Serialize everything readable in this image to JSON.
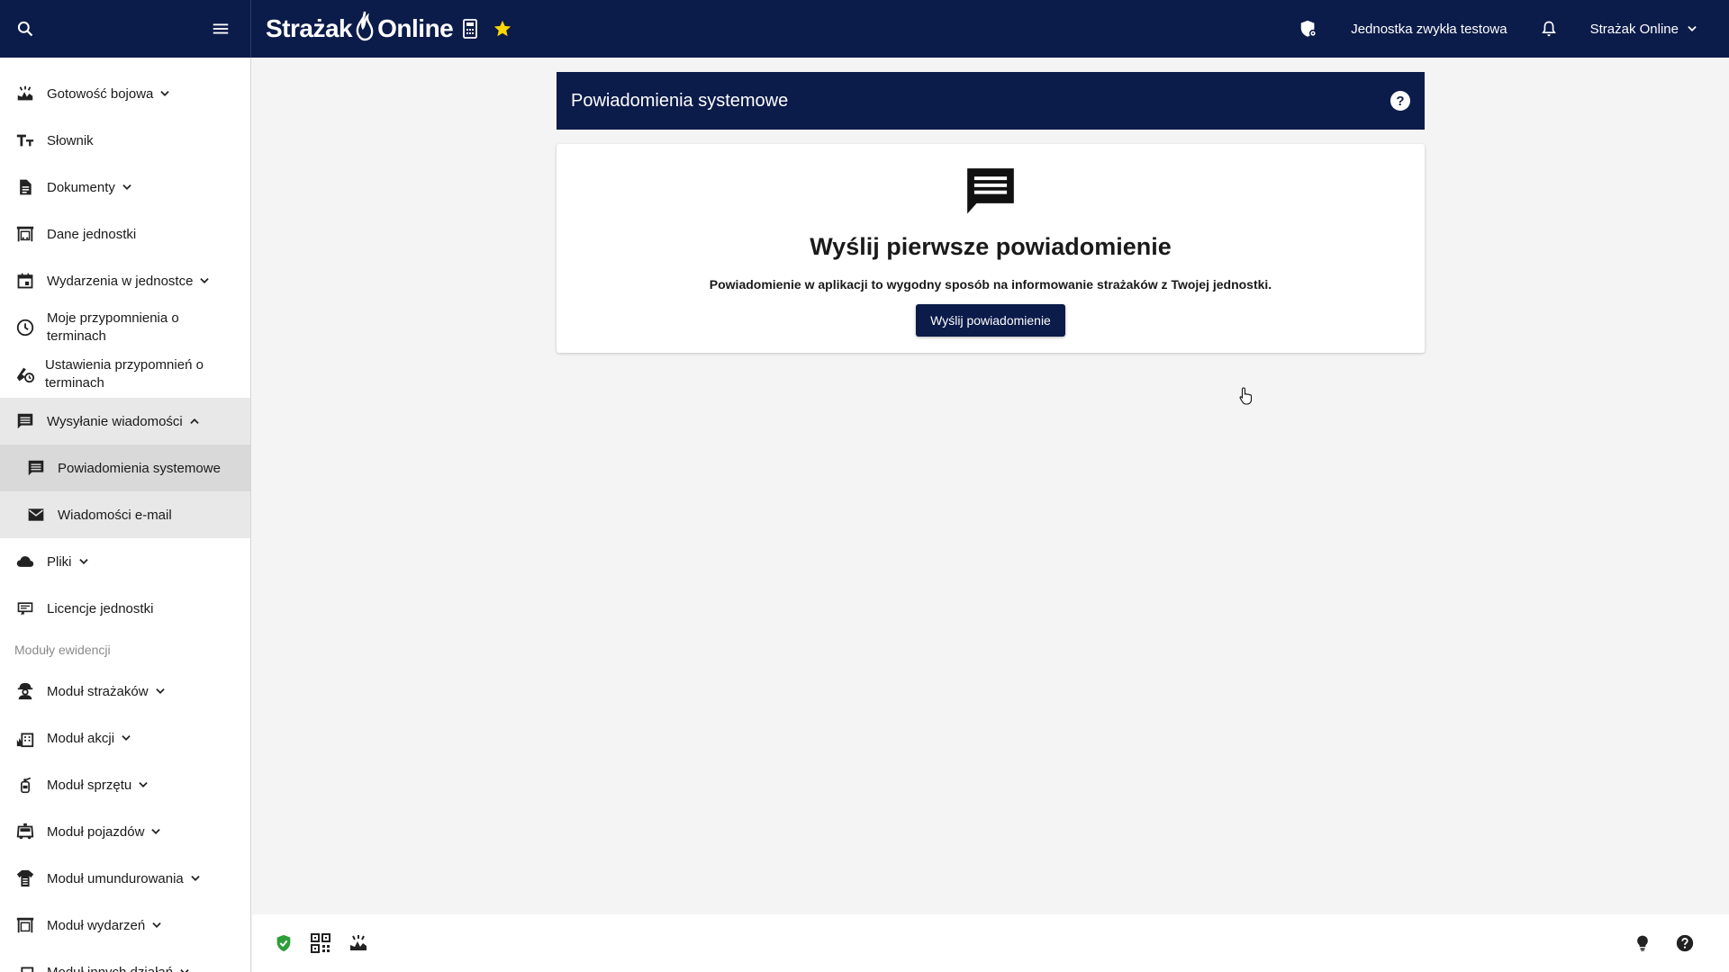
{
  "topbar": {
    "brand_left": "Strażak",
    "brand_right": "Online",
    "unit_name": "Jednostka zwykła testowa",
    "account_menu": "Strażak Online"
  },
  "sidebar": {
    "items": [
      {
        "label": "Gotowość bojowa",
        "icon": "readiness-icon"
      },
      {
        "label": "Słownik",
        "icon": "text-icon"
      },
      {
        "label": "Dokumenty",
        "icon": "document-icon"
      },
      {
        "label": "Dane jednostki",
        "icon": "fire-station-icon"
      },
      {
        "label": "Wydarzenia w jednostce",
        "icon": "calendar-icon"
      },
      {
        "label": "Moje przypomnienia o terminach",
        "icon": "clock-icon"
      },
      {
        "label": "Ustawienia przypomnień o terminach",
        "icon": "alarm-settings-icon"
      },
      {
        "label": "Wysyłanie wiadomości",
        "icon": "message-icon"
      },
      {
        "label": "Powiadomienia systemowe",
        "icon": "message-icon"
      },
      {
        "label": "Wiadomości e-mail",
        "icon": "mail-icon"
      },
      {
        "label": "Pliki",
        "icon": "cloud-icon"
      },
      {
        "label": "Licencje jednostki",
        "icon": "license-icon"
      }
    ],
    "section_label": "Moduły ewidencji",
    "modules": [
      {
        "label": "Moduł strażaków"
      },
      {
        "label": "Moduł akcji"
      },
      {
        "label": "Moduł sprzętu"
      },
      {
        "label": "Moduł pojazdów"
      },
      {
        "label": "Moduł umundurowania"
      },
      {
        "label": "Moduł wydarzeń"
      },
      {
        "label": "Moduł innych działań"
      }
    ]
  },
  "main": {
    "panel_title": "Powiadomienia systemowe",
    "help_label": "?",
    "empty_title": "Wyślij pierwsze powiadomienie",
    "empty_desc": "Powiadomienie w aplikacji to wygodny sposób na informowanie strażaków z Twojej jednostki.",
    "send_button": "Wyślij powiadomienie"
  },
  "colors": {
    "navy": "#0b1b4a",
    "accent_star": "#ffd600",
    "shield_green": "#2e9d3a"
  }
}
